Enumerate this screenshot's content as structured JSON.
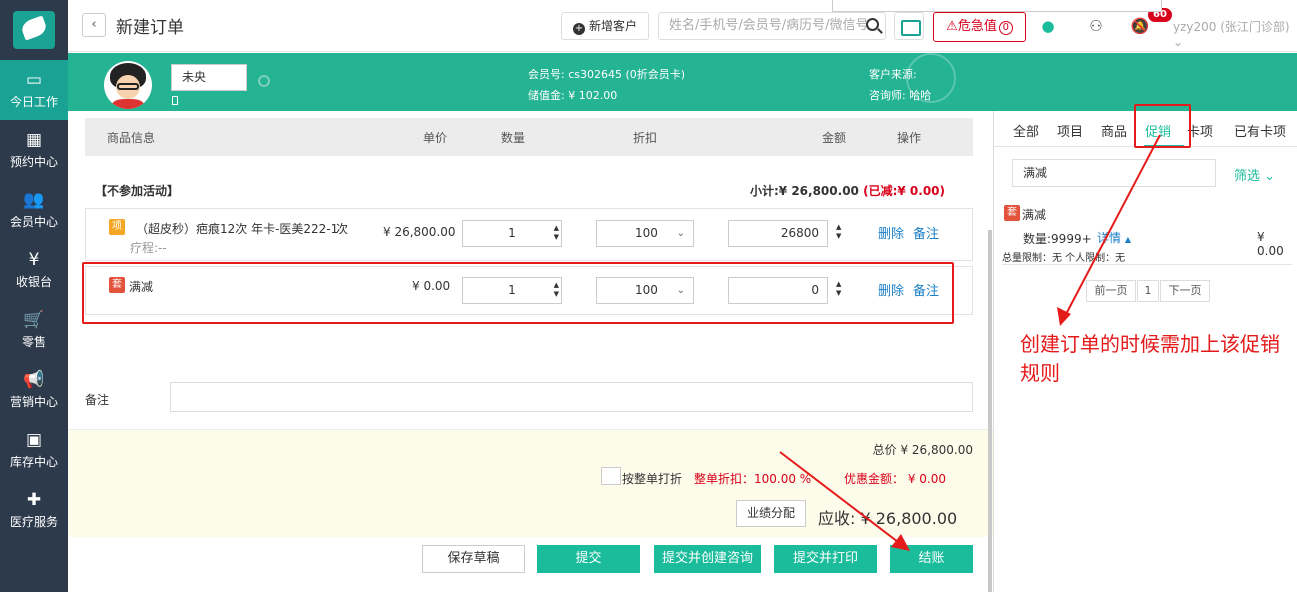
{
  "sidebar": {
    "items": [
      {
        "label": "今日工作",
        "icon": "monitor-icon",
        "glyph": "▭"
      },
      {
        "label": "预约中心",
        "icon": "calendar-icon",
        "glyph": "▦"
      },
      {
        "label": "会员中心",
        "icon": "users-icon",
        "glyph": "👥"
      },
      {
        "label": "收银台",
        "icon": "yen-icon",
        "glyph": "¥"
      },
      {
        "label": "零售",
        "icon": "cart-icon",
        "glyph": "🛒"
      },
      {
        "label": "营销中心",
        "icon": "megaphone-icon",
        "glyph": "📢"
      },
      {
        "label": "库存中心",
        "icon": "grid-icon",
        "glyph": "▣"
      },
      {
        "label": "医疗服务",
        "icon": "medkit-icon",
        "glyph": "✚"
      }
    ]
  },
  "header": {
    "back": "‹",
    "title": "新建订单",
    "new_customer": "新增客户",
    "search_placeholder": "姓名/手机号/会员号/病历号/微信号",
    "urgent_label": "危急值",
    "urgent_count": "0",
    "bell_count": "60",
    "user": "yzy200 (张江门诊部) ⌄"
  },
  "member": {
    "name": "未央",
    "member_no_label": "会员号:",
    "member_no": "cs302645 (0折会员卡)",
    "balance_label": "储值金:",
    "balance": "¥ 102.00",
    "source_label": "客户来源:",
    "source": "",
    "consultant_label": "咨询师:",
    "consultant": "哈哈"
  },
  "table": {
    "headers": {
      "info": "商品信息",
      "price": "单价",
      "qty": "数量",
      "discount": "折扣",
      "amount": "金额",
      "ops": "操作"
    },
    "group_title": "【不参加活动】",
    "subtotal_label": "小计:¥ 26,800.00",
    "subtotal_reduced": "(已减:¥ 0.00)",
    "rows": [
      {
        "tag": "项",
        "name": "（超皮秒）疤痕12次 年卡-医美222-1",
        "extra": "次",
        "sub": "疗程:--",
        "price": "¥ 26,800.00",
        "qty": "1",
        "discount": "100",
        "amount": "26800",
        "del": "删除",
        "note": "备注"
      },
      {
        "tag": "套",
        "name": "满减",
        "extra": "",
        "sub": "",
        "price": "¥ 0.00",
        "qty": "1",
        "discount": "100",
        "amount": "0",
        "del": "删除",
        "note": "备注"
      }
    ]
  },
  "remark": {
    "label": "备注",
    "value": ""
  },
  "summary": {
    "total": "总价 ¥ 26,800.00",
    "whole_discount_label": "按整单打折",
    "whole_discount": "整单折扣：100.00 %",
    "discount_amount": "优惠金额：  ¥ 0.00",
    "perf_button": "业绩分配",
    "receivable": "应收:  ¥ 26,800.00"
  },
  "actions": {
    "save_draft": "保存草稿",
    "submit": "提交",
    "submit_consult": "提交并创建咨询",
    "submit_print": "提交并打印",
    "checkout": "结账"
  },
  "right": {
    "tabs": [
      "全部",
      "项目",
      "商品",
      "促销",
      "卡项",
      "已有卡项"
    ],
    "active_tab": "促销",
    "search_value": "满减",
    "filter": "筛选",
    "promo": {
      "tag": "套",
      "name": "满减",
      "qty": "数量:9999+",
      "detail": "详情",
      "price": "¥ 0.00",
      "limit": "总量限制：无  个人限制：无"
    },
    "pager": {
      "prev": "前一页",
      "page": "1",
      "next": "下一页"
    }
  },
  "annotation": "创建订单的时候需加上该促销规则"
}
